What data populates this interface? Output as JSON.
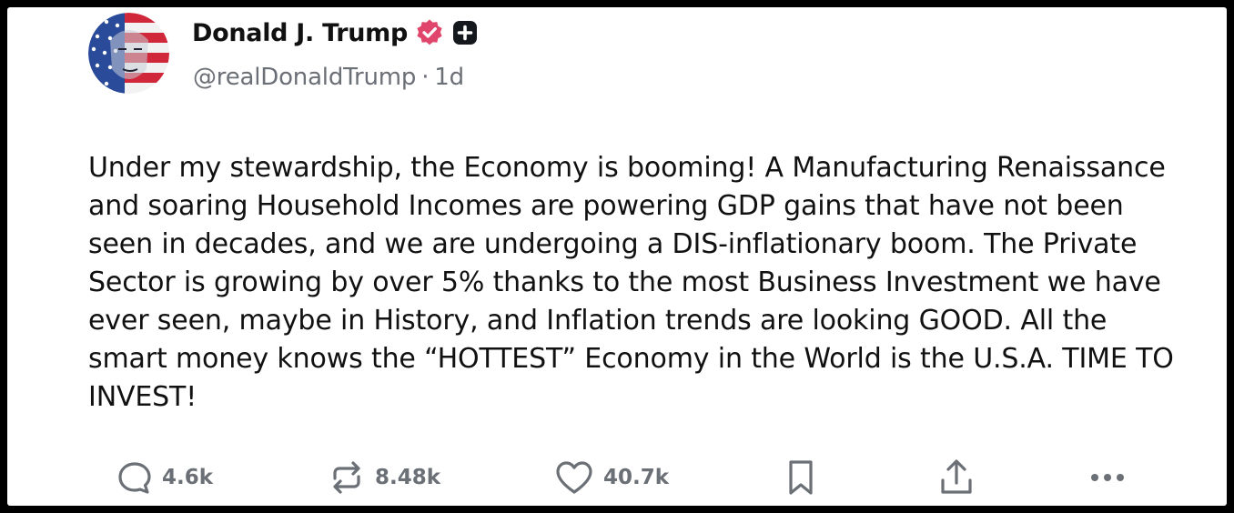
{
  "post": {
    "author_name": "Donald J. Trump",
    "handle": "@realDonaldTrump",
    "separator": "·",
    "time": "1d",
    "text": "Under my stewardship, the Economy is booming! A Manufacturing Renaissance and soaring Household Incomes are powering GDP gains that have not been seen in decades, and we are undergoing a DIS-inflationary boom. The Private Sector is growing by over 5% thanks to the most Business Investment we have ever seen, maybe in History, and Inflation trends are looking GOOD. All the smart money knows the “HOTTEST” Economy in the World is the U.S.A. TIME TO INVEST!"
  },
  "actions": {
    "replies": "4.6k",
    "retruths": "8.48k",
    "likes": "40.7k"
  },
  "icons": {
    "verified": "verified-badge-icon",
    "subscribe": "plus-square-icon",
    "reply": "speech-bubble-icon",
    "retruth": "repost-arrows-icon",
    "like": "heart-icon",
    "bookmark": "bookmark-icon",
    "share": "share-upload-icon",
    "more": "more-dots-icon"
  },
  "colors": {
    "verified": "#e0466b",
    "text": "#111111",
    "muted": "#6b6f76"
  }
}
